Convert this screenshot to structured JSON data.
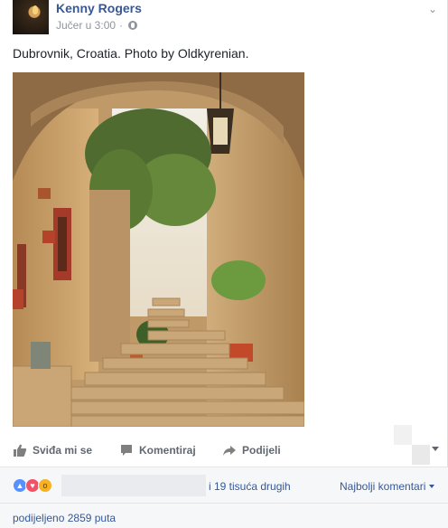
{
  "post": {
    "author": "Kenny Rogers",
    "time": "Jučer u 3:00",
    "time_separator": "·",
    "text": "Dubrovnik, Croatia. Photo by Oldkyrenian."
  },
  "actions": {
    "like_label": "Sviđa mi se",
    "comment_label": "Komentiraj",
    "share_label": "Podijeli"
  },
  "reactions": {
    "types": [
      "like-icon",
      "love-icon",
      "wow-icon"
    ],
    "others_text": "i 19 tisuća drugih",
    "sort_label": "Najbolji komentari"
  },
  "shares": {
    "text": "podijeljeno 2859 puta"
  },
  "colors": {
    "link": "#365899",
    "secondary": "#90949c",
    "action": "#616770",
    "like": "#5890ff",
    "love": "#f25268",
    "wow": "#f7b125"
  }
}
